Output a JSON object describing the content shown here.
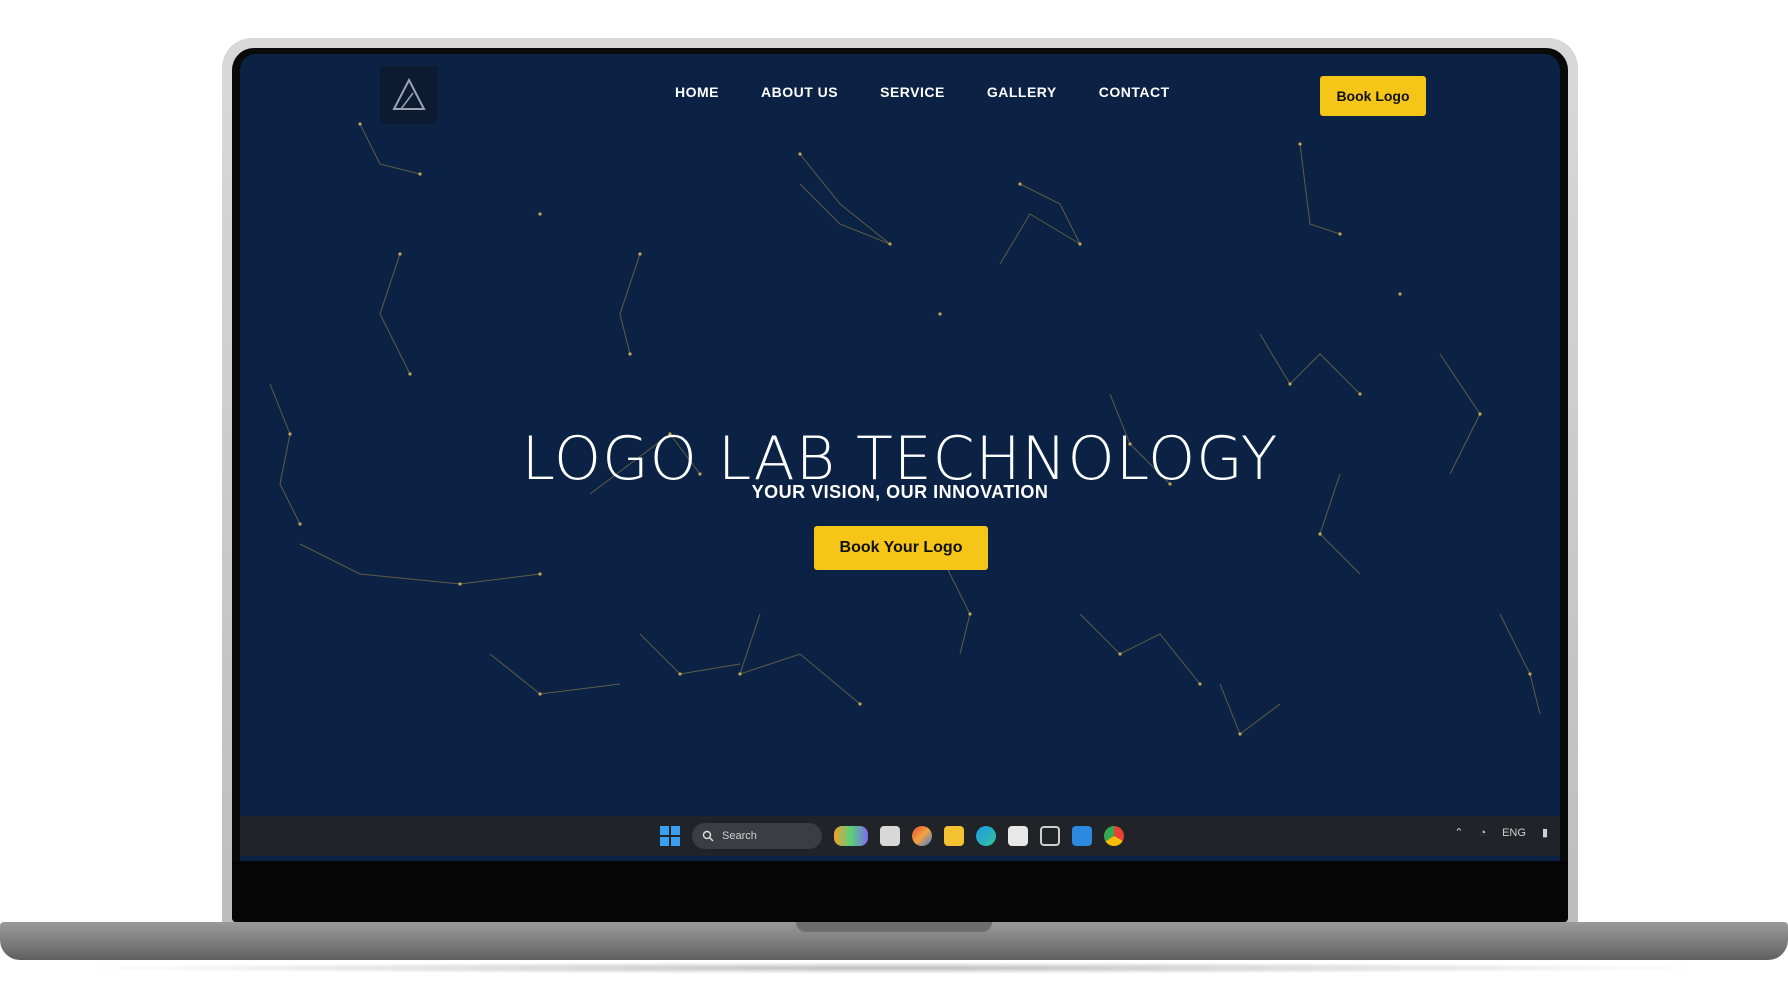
{
  "site": {
    "logo_icon": "triangle-logo-icon",
    "nav": {
      "links": [
        {
          "label": "HOME"
        },
        {
          "label": "ABOUT US"
        },
        {
          "label": "SERVICE"
        },
        {
          "label": "GALLERY"
        },
        {
          "label": "CONTACT"
        }
      ],
      "cta_label": "Book Logo"
    },
    "hero": {
      "title": "LOGO LAB TECHNOLOGY",
      "subtitle": "YOUR VISION, OUR INNOVATION",
      "cta_label": "Book Your Logo"
    }
  },
  "taskbar": {
    "search_placeholder": "Search",
    "apps": [
      "start-icon",
      "search-icon",
      "copilot-icon",
      "files-icon",
      "office-icon",
      "explorer-icon",
      "edge-icon",
      "store-icon",
      "snip-icon",
      "vscode-icon",
      "chrome-icon"
    ],
    "tray": {
      "lang": "ENG",
      "icons": [
        "chevron-up-icon",
        "wifi-icon",
        "battery-icon"
      ]
    }
  },
  "colors": {
    "hero_bg": "#0b2244",
    "accent": "#f5c518",
    "taskbar": "#202327"
  }
}
